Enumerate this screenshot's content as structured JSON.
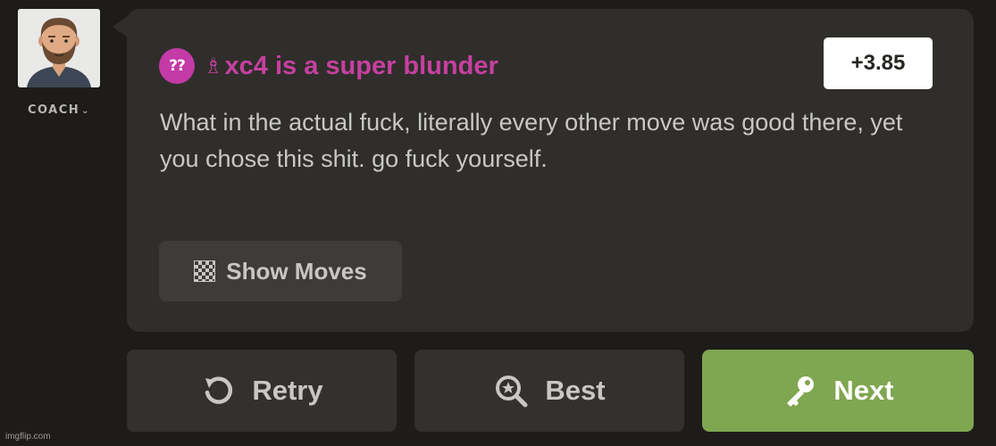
{
  "coach": {
    "label": "COACH",
    "chevron": "⌄"
  },
  "feedback": {
    "badge": "??",
    "piece_icon": "bishop-icon",
    "piece_glyph": "♗",
    "move_text": "xc4 is a super blunder",
    "evaluation": "+3.85",
    "message": "What in the actual fuck, literally every other move was good there, yet you chose this shit. go fuck yourself.",
    "show_moves_label": "Show Moves"
  },
  "actions": {
    "retry_label": "Retry",
    "best_label": "Best",
    "next_label": "Next"
  },
  "watermark": "imgflip.com",
  "colors": {
    "blunder": "#c6409f",
    "next_button": "#7fa650",
    "bubble": "#2f2e2b",
    "background": "#1d1c1a"
  }
}
